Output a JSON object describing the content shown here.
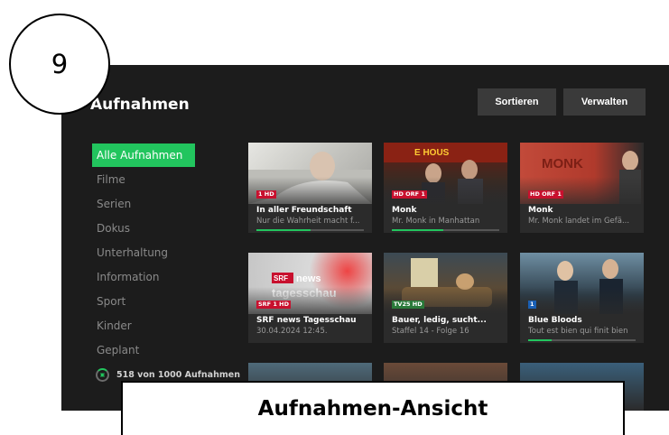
{
  "badge": {
    "number": "9"
  },
  "caption": {
    "text": "Aufnahmen-Ansicht"
  },
  "header": {
    "title": "Aufnahmen",
    "sort_label": "Sortieren",
    "manage_label": "Verwalten"
  },
  "sidebar": {
    "items": [
      {
        "label": "Alle Aufnahmen",
        "active": true
      },
      {
        "label": "Filme"
      },
      {
        "label": "Serien"
      },
      {
        "label": "Dokus"
      },
      {
        "label": "Unterhaltung"
      },
      {
        "label": "Information"
      },
      {
        "label": "Sport"
      },
      {
        "label": "Kinder"
      },
      {
        "label": "Geplant"
      }
    ],
    "quota_text": "518 von 1000 Aufnahmen",
    "quota_fraction": 0.518
  },
  "recordings": [
    {
      "title": "In aller Freundschaft",
      "subtitle": "Nur die Wahrheit macht f...",
      "channel": "1 HD",
      "progress": 0.5,
      "accent": "#d7d7d2"
    },
    {
      "title": "Monk",
      "subtitle": "Mr. Monk in Manhattan",
      "channel": "HD ORF 1",
      "progress": 0.48,
      "accent": "#7a2a1a"
    },
    {
      "title": "Monk",
      "subtitle": "Mr. Monk landet im Gefä...",
      "channel": "HD ORF 1",
      "progress": 0,
      "accent": "#b84232"
    },
    {
      "title": "SRF news Tagesschau",
      "subtitle": "30.04.2024 12:45.",
      "channel": "SRF 1 HD",
      "progress": 0,
      "accent": "#c7c7c7"
    },
    {
      "title": "Bauer, ledig, sucht...",
      "subtitle": "Staffel 14 - Folge 16",
      "channel": "TV25 HD",
      "progress": 0,
      "accent": "#6b5636"
    },
    {
      "title": "Blue Bloods",
      "subtitle": "Tout est bien qui finit bien",
      "channel": "1",
      "progress": 0.22,
      "accent": "#3f5f72"
    }
  ]
}
